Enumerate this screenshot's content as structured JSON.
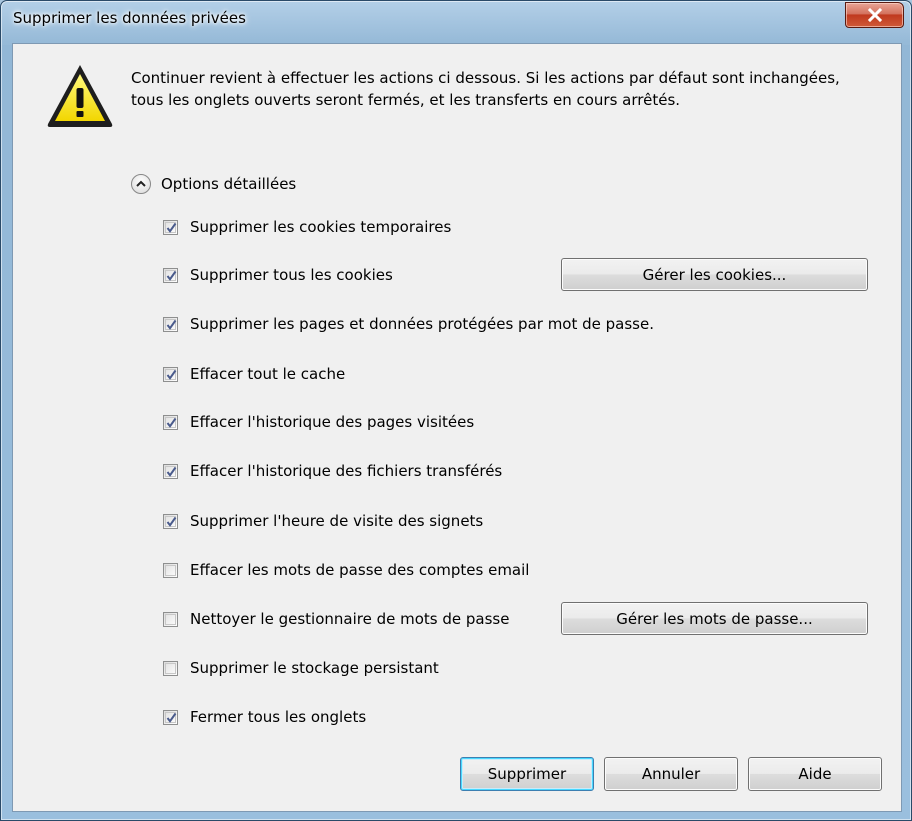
{
  "window": {
    "title": "Supprimer les données privées"
  },
  "message": {
    "line1": "Continuer revient à effectuer les actions ci dessous. Si les actions par défaut sont inchangées,",
    "line2": "tous les onglets ouverts seront fermés, et les transferts en cours arrêtés."
  },
  "details": {
    "label": "Options détaillées",
    "expanded": true
  },
  "options": [
    {
      "label": "Supprimer les cookies temporaires",
      "checked": true
    },
    {
      "label": "Supprimer tous les cookies",
      "checked": true
    },
    {
      "label": "Supprimer les pages et données protégées par mot de passe.",
      "checked": true
    },
    {
      "label": "Effacer tout le cache",
      "checked": true
    },
    {
      "label": "Effacer l'historique des pages visitées",
      "checked": true
    },
    {
      "label": "Effacer l'historique des fichiers transférés",
      "checked": true
    },
    {
      "label": "Supprimer l'heure de visite des signets",
      "checked": true
    },
    {
      "label": "Effacer les mots de passe des comptes email",
      "checked": false
    },
    {
      "label": "Nettoyer le gestionnaire de mots de passe",
      "checked": false
    },
    {
      "label": "Supprimer le stockage persistant",
      "checked": false
    },
    {
      "label": "Fermer tous les onglets",
      "checked": true
    }
  ],
  "buttons": {
    "manage_cookies": "Gérer les cookies...",
    "manage_passwords": "Gérer les mots de passe...",
    "delete": "Supprimer",
    "cancel": "Annuler",
    "help": "Aide"
  },
  "colors": {
    "check": "#4a5b8c",
    "accent": "#3c7fb1"
  }
}
